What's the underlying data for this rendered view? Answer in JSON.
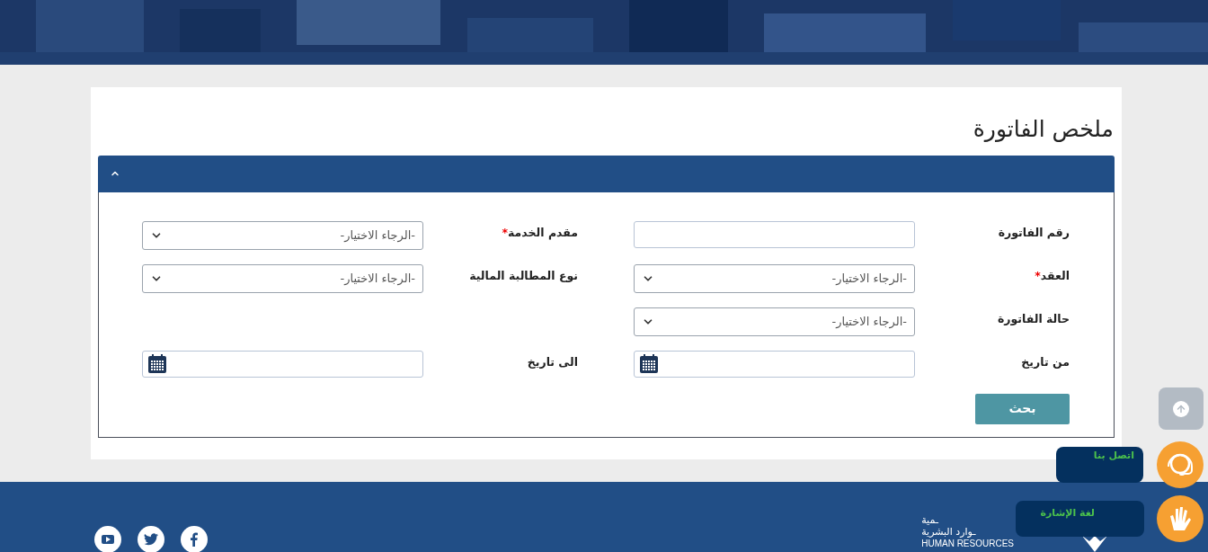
{
  "page_title": "ملخص الفاتورة",
  "panel": {
    "expanded": true,
    "rows": [
      [
        {
          "kind": "text",
          "label": "رقم الفاتورة",
          "required": false
        },
        {
          "kind": "select",
          "label": "مقدم الخدمة",
          "required": true,
          "value": "-الرجاء الاختيار-"
        }
      ],
      [
        {
          "kind": "select",
          "label": "العقد",
          "required": true,
          "value": "-الرجاء الاختيار-"
        },
        {
          "kind": "select",
          "label": "نوع المطالبة المالية",
          "required": false,
          "value": "-الرجاء الاختيار-"
        }
      ],
      [
        {
          "kind": "select",
          "label": "حالة الفاتورة",
          "required": false,
          "value": "-الرجاء الاختيار-"
        }
      ],
      [
        {
          "kind": "date",
          "label": "من تاريخ",
          "required": false
        },
        {
          "kind": "date",
          "label": "الى تاريخ",
          "required": false
        }
      ]
    ],
    "required_mark": "*",
    "search_button": "بحث"
  },
  "floating": {
    "contact_tooltip": "اتصل بنا",
    "sign_language_tooltip": "لغة الإشارة"
  },
  "footer": {
    "logo_lines": [
      "ـمية",
      "ـوارد البشرية",
      "HUMAN RESOURCES"
    ]
  }
}
